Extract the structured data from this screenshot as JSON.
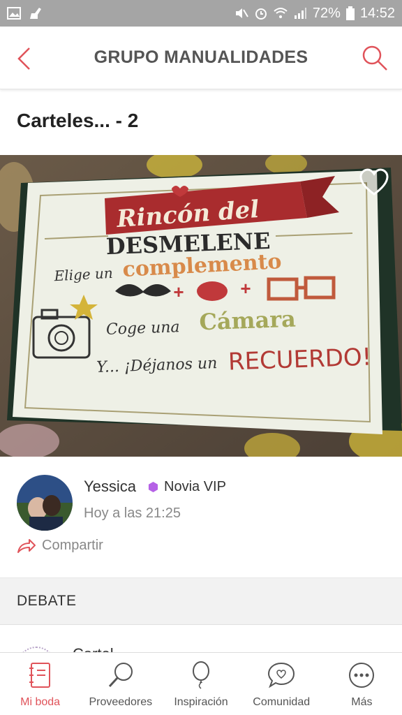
{
  "status_bar": {
    "battery": "72%",
    "time": "14:52"
  },
  "header": {
    "title": "GRUPO MANUALIDADES",
    "back_icon": "chevron-left-icon",
    "search_icon": "search-icon"
  },
  "post": {
    "title": "Carteles... - 2",
    "image_text": {
      "line1": "Rincón del",
      "line2": "DESMELENE",
      "line3a": "Elige un",
      "line3b": "complemento",
      "line4a": "Coge una",
      "line4b": "Cámara",
      "line5a": "Y... ¡Déjanos un",
      "line5b": "RECUERDO!"
    },
    "favorite_icon": "heart-icon"
  },
  "author": {
    "name": "Yessica",
    "badge": "Novia VIP",
    "time": "Hoy a las 21:25"
  },
  "share": {
    "label": "Compartir"
  },
  "debate": {
    "heading": "DEBATE",
    "next_preview": "Cartel"
  },
  "colors": {
    "accent": "#e0535a",
    "vip_badge": "#b561e6",
    "status_bar": "#a5a5a5"
  },
  "bottom_nav": {
    "items": [
      {
        "label": "Mi boda",
        "icon": "notebook-icon",
        "active": true
      },
      {
        "label": "Proveedores",
        "icon": "magnifier-icon",
        "active": false
      },
      {
        "label": "Inspiración",
        "icon": "balloon-icon",
        "active": false
      },
      {
        "label": "Comunidad",
        "icon": "chat-heart-icon",
        "active": false
      },
      {
        "label": "Más",
        "icon": "more-icon",
        "active": false
      }
    ]
  }
}
